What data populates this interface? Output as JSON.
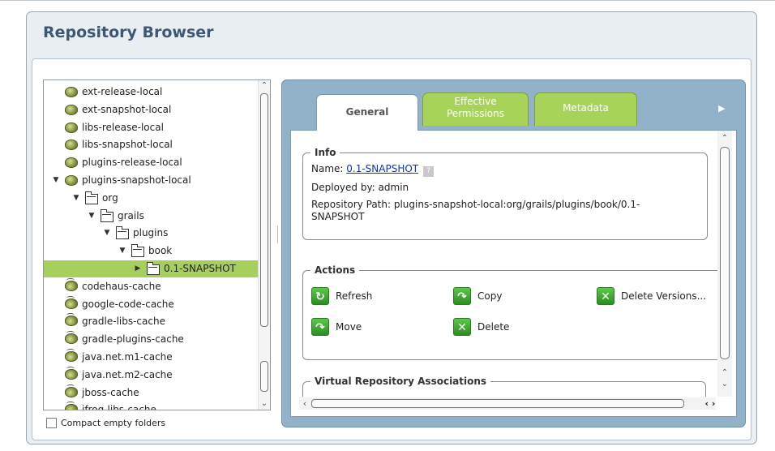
{
  "window": {
    "title": "Repository Browser"
  },
  "tree": {
    "items": [
      {
        "label": "ext-release-local",
        "type": "repo",
        "level": 0,
        "expanded": false,
        "has_arrow": false
      },
      {
        "label": "ext-snapshot-local",
        "type": "repo",
        "level": 0,
        "expanded": false,
        "has_arrow": false
      },
      {
        "label": "libs-release-local",
        "type": "repo",
        "level": 0,
        "expanded": false,
        "has_arrow": false
      },
      {
        "label": "libs-snapshot-local",
        "type": "repo",
        "level": 0,
        "expanded": false,
        "has_arrow": false
      },
      {
        "label": "plugins-release-local",
        "type": "repo",
        "level": 0,
        "expanded": false,
        "has_arrow": false
      },
      {
        "label": "plugins-snapshot-local",
        "type": "repo",
        "level": 0,
        "expanded": true,
        "has_arrow": true
      },
      {
        "label": "org",
        "type": "folder",
        "level": 1,
        "expanded": true,
        "has_arrow": true
      },
      {
        "label": "grails",
        "type": "folder",
        "level": 2,
        "expanded": true,
        "has_arrow": true
      },
      {
        "label": "plugins",
        "type": "folder",
        "level": 3,
        "expanded": true,
        "has_arrow": true
      },
      {
        "label": "book",
        "type": "folder",
        "level": 4,
        "expanded": true,
        "has_arrow": true
      },
      {
        "label": "0.1-SNAPSHOT",
        "type": "folder",
        "level": 5,
        "expanded": false,
        "has_arrow": true,
        "selected": true
      },
      {
        "label": "codehaus-cache",
        "type": "cache",
        "level": 0,
        "expanded": false,
        "has_arrow": false
      },
      {
        "label": "google-code-cache",
        "type": "cache",
        "level": 0,
        "expanded": false,
        "has_arrow": false
      },
      {
        "label": "gradle-libs-cache",
        "type": "cache",
        "level": 0,
        "expanded": false,
        "has_arrow": false
      },
      {
        "label": "gradle-plugins-cache",
        "type": "cache",
        "level": 0,
        "expanded": false,
        "has_arrow": false
      },
      {
        "label": "java.net.m1-cache",
        "type": "cache",
        "level": 0,
        "expanded": false,
        "has_arrow": false
      },
      {
        "label": "java.net.m2-cache",
        "type": "cache",
        "level": 0,
        "expanded": false,
        "has_arrow": false
      },
      {
        "label": "jboss-cache",
        "type": "cache",
        "level": 0,
        "expanded": false,
        "has_arrow": false
      },
      {
        "label": "jfrog-libs-cache",
        "type": "cache",
        "level": 0,
        "expanded": false,
        "has_arrow": false
      }
    ],
    "scroll": {
      "up_icon": "chevron-up-icon",
      "down_icon": "chevron-down-icon"
    }
  },
  "compact_empty_folders": {
    "label": "Compact empty folders",
    "checked": false
  },
  "tabs": [
    {
      "label": "General",
      "active": true
    },
    {
      "label": "Effective Permissions",
      "active": false
    },
    {
      "label": "Metadata",
      "active": false
    }
  ],
  "tab_overflow_icon": "triangle-right-icon",
  "info": {
    "legend": "Info",
    "name_prefix": "Name: ",
    "name_value": "0.1-SNAPSHOT",
    "help_icon": "?",
    "deployed_by": "Deployed by: admin",
    "repo_path_line1": "Repository Path: plugins-snapshot-local:org/grails/plugins/book/0.1-",
    "repo_path_line2": "SNAPSHOT"
  },
  "actions": {
    "legend": "Actions",
    "items": [
      {
        "label": "Refresh",
        "icon": "refresh-icon"
      },
      {
        "label": "Copy",
        "icon": "copy-icon"
      },
      {
        "label": "Delete Versions...",
        "icon": "delete-versions-icon"
      },
      {
        "label": "Move",
        "icon": "move-icon"
      },
      {
        "label": "Delete",
        "icon": "delete-icon"
      }
    ]
  },
  "virtual_repo": {
    "legend": "Virtual Repository Associations"
  },
  "colors": {
    "accent_green": "#a7d35a",
    "selected_row": "#a6cf5e",
    "panel_blue": "#92b2c9",
    "title_blue": "#3d5873",
    "link_blue": "#0b32c9"
  }
}
